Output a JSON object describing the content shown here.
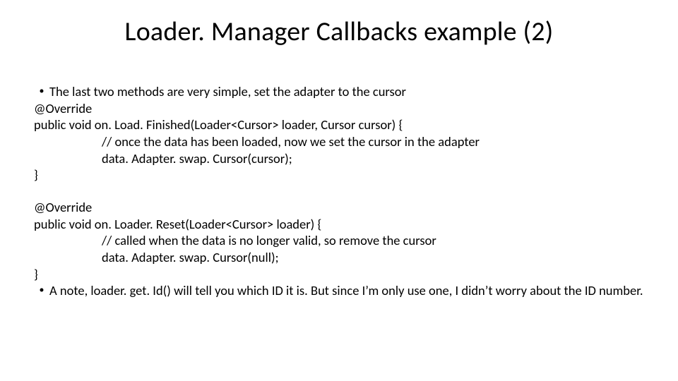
{
  "title": "Loader. Manager Callbacks example (2)",
  "b1": "The last two methods are very simple,  set the adapter to the cursor",
  "l1": "@Override",
  "l2": "public void on. Load. Finished(Loader<Cursor> loader, Cursor cursor) {",
  "l3": "//  once the data has been loaded, now we set the cursor in the adapter",
  "l4": "data. Adapter. swap. Cursor(cursor);",
  "l5": "}",
  "l6": "@Override",
  "l7": "public void on. Loader. Reset(Loader<Cursor> loader) {",
  "l8": "// called when the data is no longer valid, so remove the cursor",
  "l9": "data. Adapter. swap. Cursor(null);",
  "l10": "}",
  "b2": "A note, loader. get. Id() will tell you which ID it is.  But since I’m only use one, I didn’t worry about the ID number."
}
